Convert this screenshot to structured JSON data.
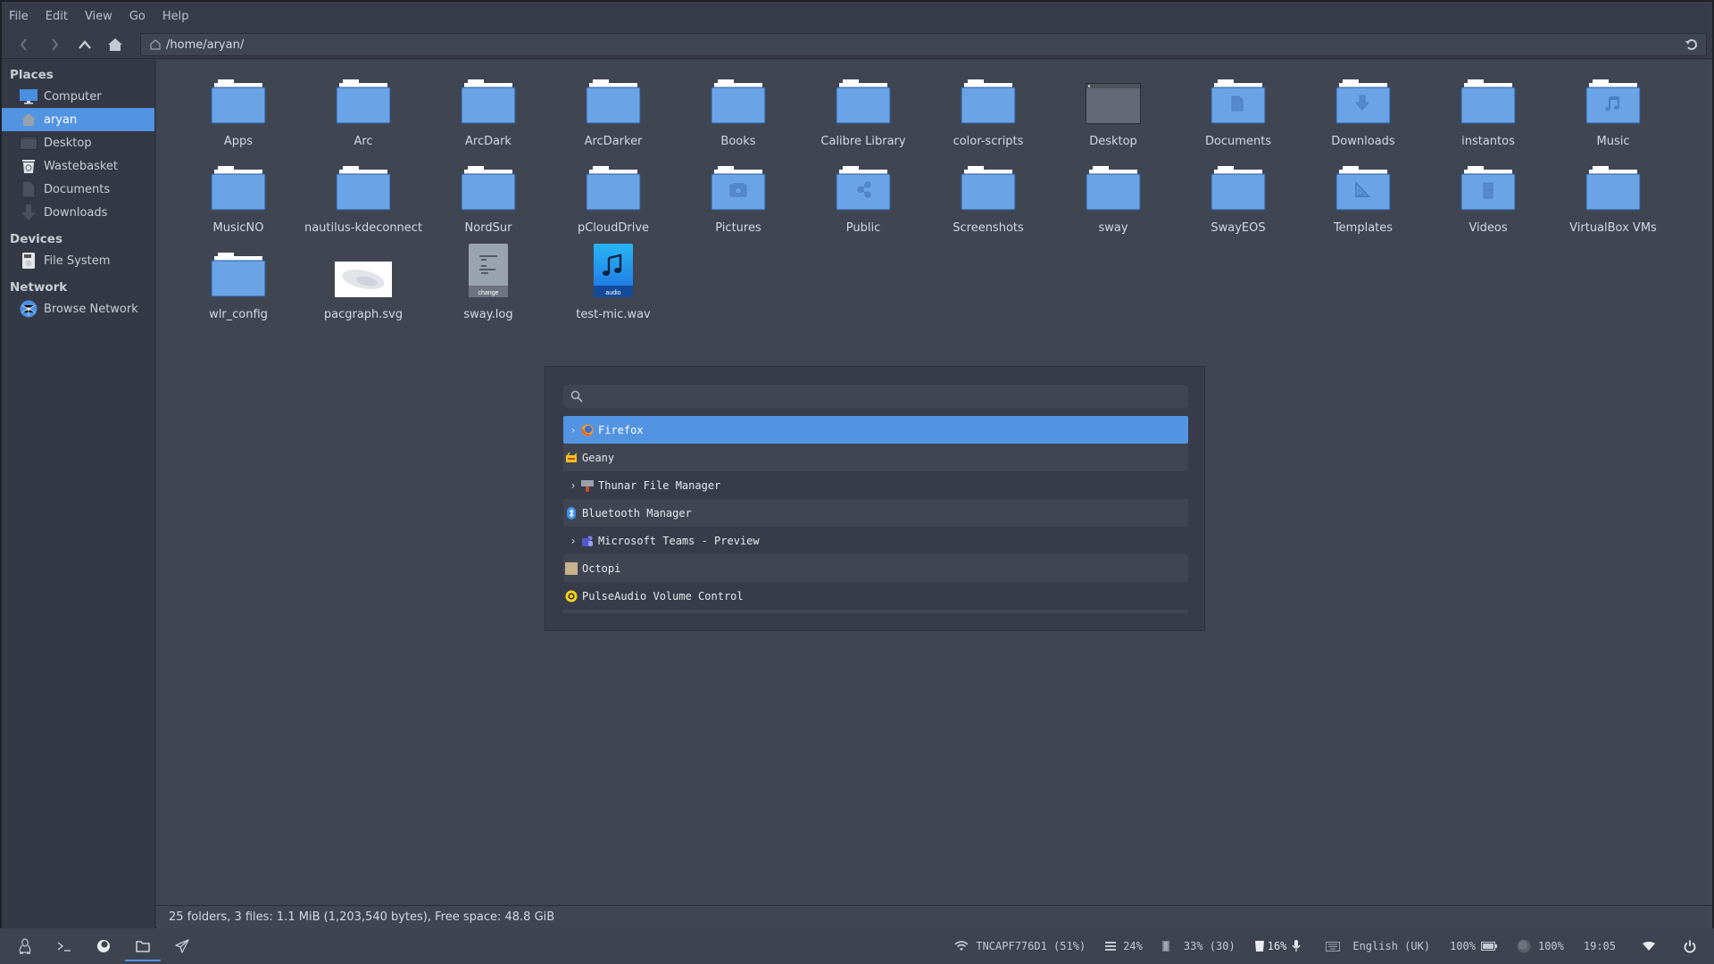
{
  "menu": [
    "File",
    "Edit",
    "View",
    "Go",
    "Help"
  ],
  "toolbar": {
    "back_icon": "chevron-left-icon",
    "forward_icon": "chevron-right-icon",
    "up_icon": "chevron-up-icon",
    "home_icon": "home-icon",
    "location": "/home/aryan/",
    "reload_icon": "reload-icon"
  },
  "sidebar": {
    "sections": [
      {
        "title": "Places",
        "items": [
          {
            "label": "Computer",
            "icon": "computer-icon"
          },
          {
            "label": "aryan",
            "icon": "home-icon",
            "active": true
          },
          {
            "label": "Desktop",
            "icon": "desktop-icon"
          },
          {
            "label": "Wastebasket",
            "icon": "trash-icon"
          },
          {
            "label": "Documents",
            "icon": "document-icon"
          },
          {
            "label": "Downloads",
            "icon": "download-icon"
          }
        ]
      },
      {
        "title": "Devices",
        "items": [
          {
            "label": "File System",
            "icon": "drive-icon"
          }
        ]
      },
      {
        "title": "Network",
        "items": [
          {
            "label": "Browse Network",
            "icon": "network-icon"
          }
        ]
      }
    ]
  },
  "files": [
    {
      "name": "Apps",
      "type": "folder"
    },
    {
      "name": "Arc",
      "type": "folder"
    },
    {
      "name": "ArcDark",
      "type": "folder"
    },
    {
      "name": "ArcDarker",
      "type": "folder"
    },
    {
      "name": "Books",
      "type": "folder"
    },
    {
      "name": "Calibre Library",
      "type": "folder"
    },
    {
      "name": "color-scripts",
      "type": "folder"
    },
    {
      "name": "Desktop",
      "type": "desktop"
    },
    {
      "name": "Documents",
      "type": "folder",
      "emblem": "document"
    },
    {
      "name": "Downloads",
      "type": "folder",
      "emblem": "download"
    },
    {
      "name": "instantos",
      "type": "folder"
    },
    {
      "name": "Music",
      "type": "folder",
      "emblem": "music"
    },
    {
      "name": "MusicNO",
      "type": "folder"
    },
    {
      "name": "nautilus-kdeconnect",
      "type": "folder"
    },
    {
      "name": "NordSur",
      "type": "folder"
    },
    {
      "name": "pCloudDrive",
      "type": "folder"
    },
    {
      "name": "Pictures",
      "type": "folder",
      "emblem": "camera"
    },
    {
      "name": "Public",
      "type": "folder",
      "emblem": "share"
    },
    {
      "name": "Screenshots",
      "type": "folder"
    },
    {
      "name": "sway",
      "type": "folder"
    },
    {
      "name": "SwayEOS",
      "type": "folder"
    },
    {
      "name": "Templates",
      "type": "folder",
      "emblem": "template"
    },
    {
      "name": "Videos",
      "type": "folder",
      "emblem": "film"
    },
    {
      "name": "VirtualBox VMs",
      "type": "folder"
    },
    {
      "name": "wlr_config",
      "type": "folder"
    },
    {
      "name": "pacgraph.svg",
      "type": "image"
    },
    {
      "name": "sway.log",
      "type": "log",
      "badge": "change"
    },
    {
      "name": "test-mic.wav",
      "type": "audio",
      "badge": "audio"
    }
  ],
  "status": "25 folders, 3 files: 1.1 MiB (1,203,540 bytes), Free space: 48.8 GiB",
  "launcher": {
    "search_placeholder": "",
    "search_value": "",
    "items": [
      {
        "label": "Firefox",
        "icon": "firefox-icon",
        "expandable": true,
        "selected": true
      },
      {
        "label": "Geany",
        "icon": "geany-icon",
        "expandable": false
      },
      {
        "label": "Thunar File Manager",
        "icon": "thunar-icon",
        "expandable": true
      },
      {
        "label": "Bluetooth Manager",
        "icon": "bluetooth-icon",
        "expandable": false
      },
      {
        "label": "Microsoft Teams - Preview",
        "icon": "teams-icon",
        "expandable": true
      },
      {
        "label": "Octopi",
        "icon": "octopi-icon",
        "expandable": false
      },
      {
        "label": "PulseAudio Volume Control",
        "icon": "pulseaudio-icon",
        "expandable": false
      }
    ]
  },
  "taskbar": {
    "apps": [
      {
        "name": "linux-icon"
      },
      {
        "name": "terminal-icon"
      },
      {
        "name": "browser-icon"
      },
      {
        "name": "folder-icon",
        "active": true
      },
      {
        "name": "telegram-icon"
      }
    ],
    "tray": {
      "wifi": "TNCAPF776D1 (51%)",
      "cpu": "24%",
      "memory": "33% (30)",
      "disk": "16%",
      "keyboard": "English (UK)",
      "battery": "100%",
      "volume": "100%",
      "clock": "19:05"
    }
  },
  "colors": {
    "accent": "#5294e2",
    "folder": "#6aa4e6",
    "bg": "#404552"
  }
}
